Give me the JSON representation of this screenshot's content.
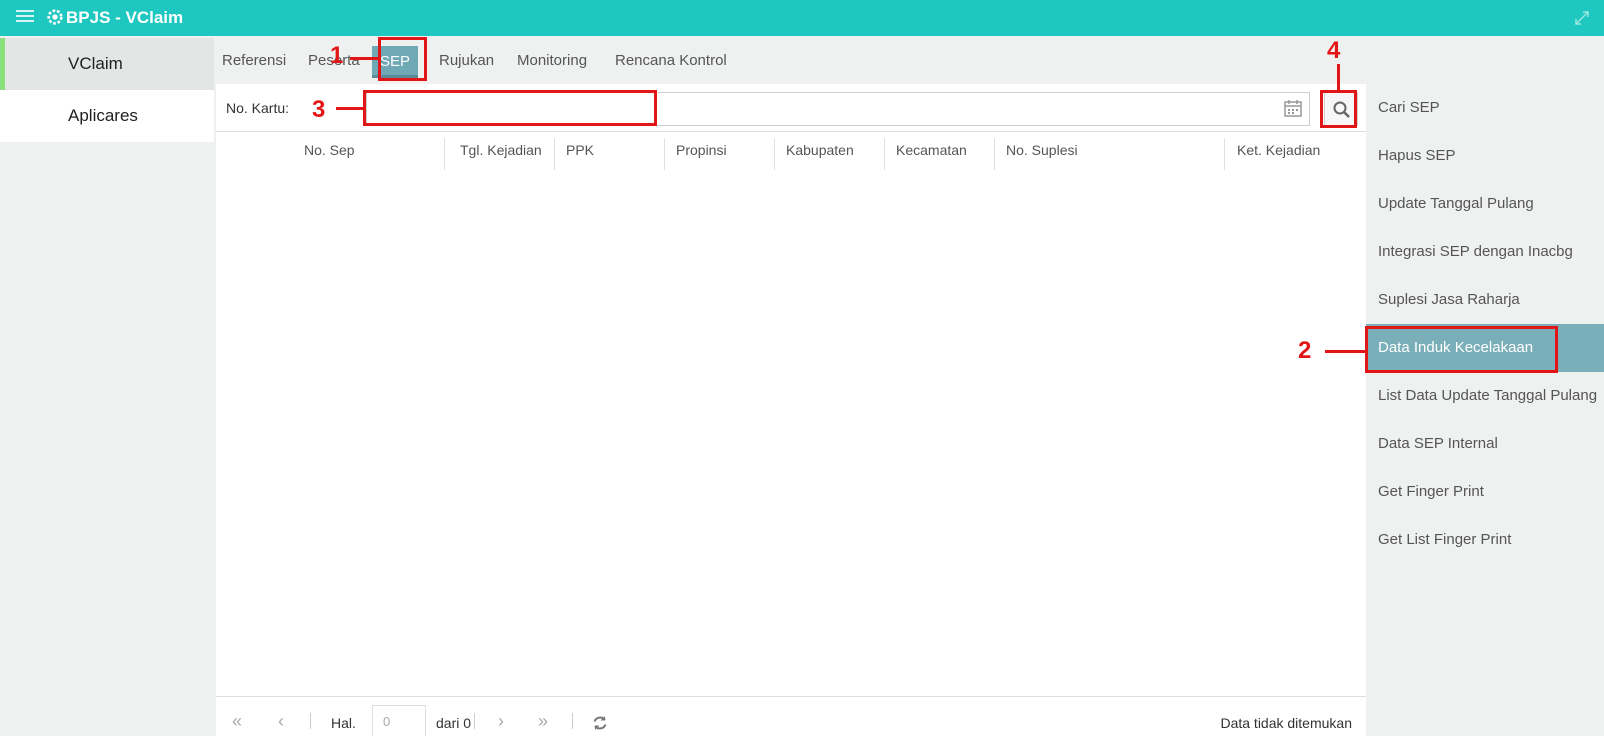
{
  "app": {
    "title": "BPJS - VClaim"
  },
  "left_nav": {
    "items": [
      {
        "label": "VClaim"
      },
      {
        "label": "Aplicares"
      }
    ]
  },
  "tabs": [
    {
      "label": "Referensi"
    },
    {
      "label": "Peserta"
    },
    {
      "label": "SEP"
    },
    {
      "label": "Rujukan"
    },
    {
      "label": "Monitoring"
    },
    {
      "label": "Rencana Kontrol"
    }
  ],
  "search": {
    "label": "No. Kartu:",
    "value": ""
  },
  "table": {
    "columns": [
      "No. Sep",
      "Tgl. Kejadian",
      "PPK",
      "Propinsi",
      "Kabupaten",
      "Kecamatan",
      "No. Suplesi",
      "Ket. Kejadian"
    ]
  },
  "pager": {
    "hal_label": "Hal.",
    "page_value": "0",
    "dari_label": "dari 0",
    "status": "Data tidak ditemukan"
  },
  "right_menu": {
    "items": [
      {
        "label": "Cari SEP"
      },
      {
        "label": "Hapus SEP"
      },
      {
        "label": "Update Tanggal Pulang"
      },
      {
        "label": "Integrasi SEP dengan Inacbg"
      },
      {
        "label": "Suplesi Jasa Raharja"
      },
      {
        "label": "Data Induk Kecelakaan"
      },
      {
        "label": "List Data Update Tanggal Pulang"
      },
      {
        "label": "Data SEP Internal"
      },
      {
        "label": "Get Finger Print"
      },
      {
        "label": "Get List Finger Print"
      }
    ]
  },
  "annotations": {
    "n1": "1",
    "n2": "2",
    "n3": "3",
    "n4": "4"
  },
  "colors": {
    "header": "#1ec7bf",
    "active": "#7aaeb9",
    "annotation": "#e21616"
  }
}
